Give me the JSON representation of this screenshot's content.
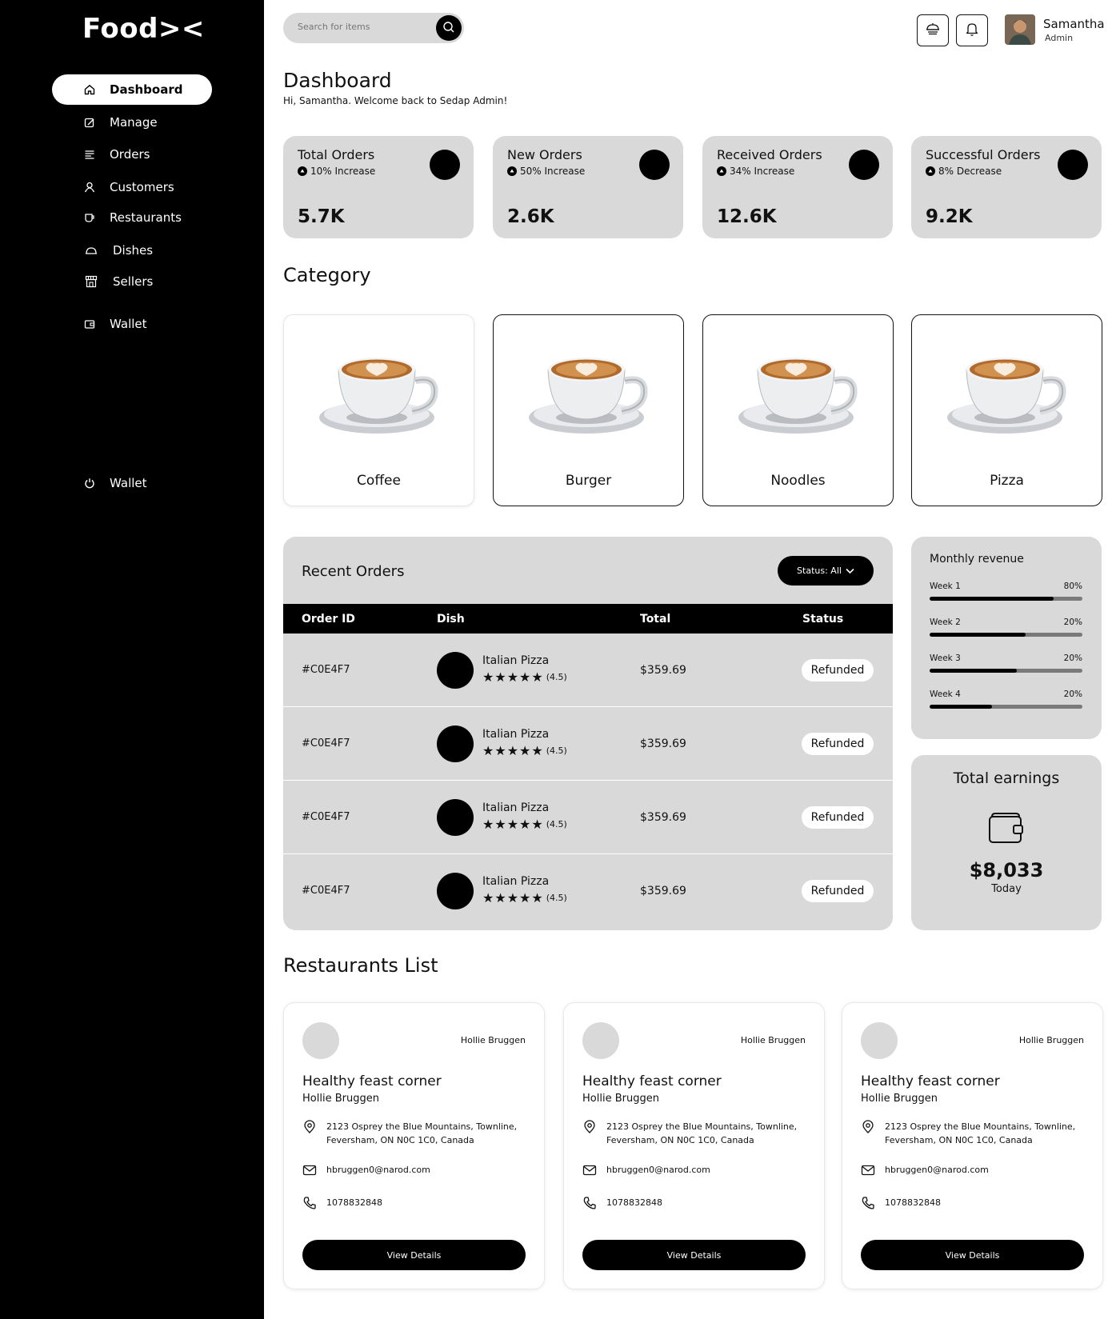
{
  "app": {
    "logo": "Food><"
  },
  "sidebar": {
    "items": [
      {
        "label": "Dashboard",
        "icon": "home-icon",
        "active": true
      },
      {
        "label": "Manage",
        "icon": "edit-icon"
      },
      {
        "label": "Orders",
        "icon": "list-icon"
      },
      {
        "label": "Customers",
        "icon": "user-icon"
      },
      {
        "label": "Restaurants",
        "icon": "cup-icon"
      },
      {
        "label": "Dishes",
        "icon": "cloche-icon"
      },
      {
        "label": "Sellers",
        "icon": "store-icon"
      },
      {
        "label": "Wallet",
        "icon": "wallet-icon"
      }
    ],
    "bottom_item": {
      "label": "Wallet",
      "icon": "power-icon"
    }
  },
  "header": {
    "search_placeholder": "Search for items",
    "user_name": "Samantha",
    "user_role": "Admin"
  },
  "page": {
    "title": "Dashboard",
    "subtitle": "Hi, Samantha. Welcome back  to Sedap Admin!"
  },
  "stats": [
    {
      "label": "Total Orders",
      "change": "10% Increase",
      "value": "5.7K"
    },
    {
      "label": "New Orders",
      "change": "50% Increase",
      "value": "2.6K"
    },
    {
      "label": "Received Orders",
      "change": "34% Increase",
      "value": "12.6K"
    },
    {
      "label": "Successful Orders",
      "change": "8% Decrease",
      "value": "9.2K"
    }
  ],
  "category": {
    "title": "Category",
    "items": [
      "Coffee",
      "Burger",
      "Noodles",
      "Pizza"
    ]
  },
  "recent_orders": {
    "title": "Recent Orders",
    "status_filter": "Status: All",
    "columns": [
      "Order ID",
      "Dish",
      "Total",
      "Status"
    ],
    "rows": [
      {
        "id": "#C0E4F7",
        "dish": "Italian Pizza",
        "rating": "(4.5)",
        "total": "$359.69",
        "status": "Refunded"
      },
      {
        "id": "#C0E4F7",
        "dish": "Italian Pizza",
        "rating": "(4.5)",
        "total": "$359.69",
        "status": "Refunded"
      },
      {
        "id": "#C0E4F7",
        "dish": "Italian Pizza",
        "rating": "(4.5)",
        "total": "$359.69",
        "status": "Refunded"
      },
      {
        "id": "#C0E4F7",
        "dish": "Italian Pizza",
        "rating": "(4.5)",
        "total": "$359.69",
        "status": "Refunded"
      }
    ]
  },
  "monthly_revenue": {
    "title": "Monthly revenue",
    "weeks": [
      {
        "label": "Week 1",
        "percent": "80%",
        "fill": 0.81
      },
      {
        "label": "Week 2",
        "percent": "20%",
        "fill": 0.63
      },
      {
        "label": "Week 3",
        "percent": "20%",
        "fill": 0.57
      },
      {
        "label": "Week 4",
        "percent": "20%",
        "fill": 0.41
      }
    ]
  },
  "earnings": {
    "title": "Total earnings",
    "amount": "$8,033",
    "period": "Today"
  },
  "restaurants": {
    "title": "Restaurants List",
    "items": [
      {
        "owner_tag": "Hollie Bruggen",
        "name": "Healthy feast corner",
        "owner": "Hollie Bruggen",
        "address1": "2123 Osprey the Blue Mountains, Townline,",
        "address2": "Feversham, ON N0C 1C0, Canada",
        "email": "hbruggen0@narod.com",
        "phone": "1078832848",
        "button": "View Details"
      },
      {
        "owner_tag": "Hollie Bruggen",
        "name": "Healthy feast corner",
        "owner": "Hollie Bruggen",
        "address1": "2123 Osprey the Blue Mountains, Townline,",
        "address2": "Feversham, ON N0C 1C0, Canada",
        "email": "hbruggen0@narod.com",
        "phone": "1078832848",
        "button": "View Details"
      },
      {
        "owner_tag": "Hollie Bruggen",
        "name": "Healthy feast corner",
        "owner": "Hollie Bruggen",
        "address1": "2123 Osprey the Blue Mountains, Townline,",
        "address2": "Feversham, ON N0C 1C0, Canada",
        "email": "hbruggen0@narod.com",
        "phone": "1078832848",
        "button": "View Details"
      }
    ]
  }
}
